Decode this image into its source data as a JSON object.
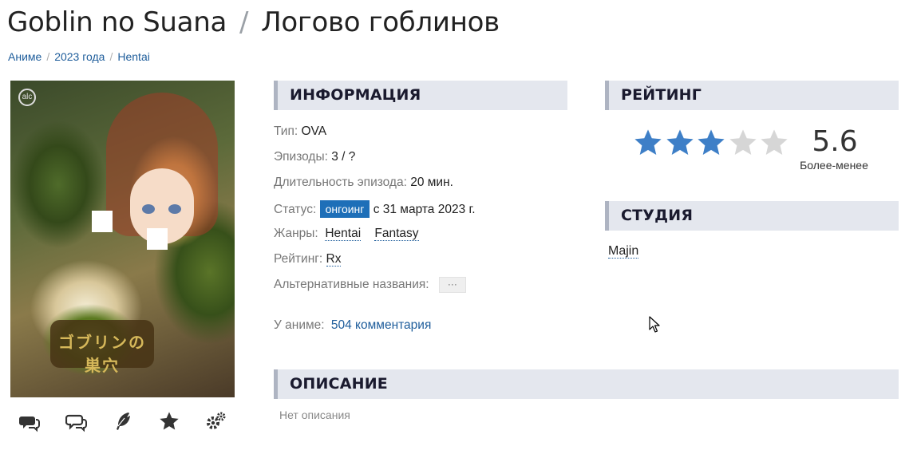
{
  "title": {
    "romaji": "Goblin no Suana",
    "separator": "/",
    "russian": "Логово гоблинов"
  },
  "breadcrumb": [
    {
      "label": "Аниме"
    },
    {
      "label": "2023 года"
    },
    {
      "label": "Hentai"
    }
  ],
  "breadcrumb_separator": "/",
  "poster": {
    "logo_text": "ゴブリンの巣穴",
    "brand": "alc"
  },
  "poster_actions": [
    {
      "icon": "comments-icon"
    },
    {
      "icon": "reviews-icon"
    },
    {
      "icon": "feather-icon"
    },
    {
      "icon": "star-icon"
    },
    {
      "icon": "settings-icon"
    }
  ],
  "sections": {
    "info": "ИНФОРМАЦИЯ",
    "rating": "РЕЙТИНГ",
    "studio": "СТУДИЯ",
    "description": "ОПИСАНИЕ"
  },
  "info": {
    "type_label": "Тип:",
    "type_value": "OVA",
    "episodes_label": "Эпизоды:",
    "episodes_value": "3 / ?",
    "duration_label": "Длительность эпизода:",
    "duration_value": "20 мин.",
    "status_label": "Статус:",
    "status_badge": "онгоинг",
    "status_date": "с 31 марта 2023 г.",
    "genres_label": "Жанры:",
    "genres": [
      "Hentai",
      "Fantasy"
    ],
    "rating_label": "Рейтинг:",
    "rating_value": "Rx",
    "alt_names_label": "Альтернативные названия:",
    "alt_names_button": "···"
  },
  "comments": {
    "label": "У аниме:",
    "link": "504 комментария"
  },
  "rating": {
    "score": "5.6",
    "score_label": "Более-менее",
    "stars_filled": 3,
    "stars_total": 5
  },
  "studio": {
    "name": "Majin"
  },
  "description": {
    "empty_text": "Нет описания"
  },
  "colors": {
    "link": "#1e5d9b",
    "badge": "#1e6fb8",
    "star_filled": "#3e7fc7",
    "star_empty": "#d6d6d6",
    "section_bg": "#e4e7ee"
  }
}
